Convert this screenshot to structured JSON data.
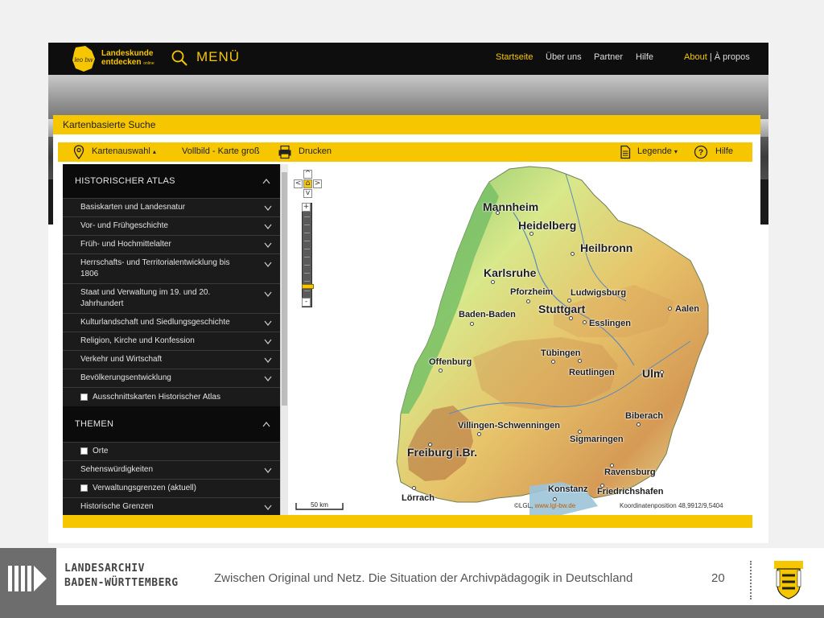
{
  "site": {
    "logo": {
      "badge": "leo bw",
      "line1": "Landeskunde",
      "line2": "entdecken",
      "line2_suffix": "online"
    },
    "menu_label": "MENÜ",
    "nav": [
      {
        "label": "Startseite",
        "active": true
      },
      {
        "label": "Über uns",
        "active": false
      },
      {
        "label": "Partner",
        "active": false
      },
      {
        "label": "Hilfe",
        "active": false
      }
    ],
    "about": {
      "about": "About",
      "separator": "|",
      "apropos": "À propos"
    }
  },
  "panel": {
    "title": "Kartenbasierte Suche",
    "toolbar": {
      "kartenauswahl": "Kartenauswahl",
      "vollbild": "Vollbild - Karte groß",
      "drucken": "Drucken",
      "legende": "Legende",
      "hilfe": "Hilfe"
    }
  },
  "sidebar": {
    "section1": {
      "title": "HISTORISCHER ATLAS",
      "items": [
        {
          "label": "Basiskarten und Landesnatur"
        },
        {
          "label": "Vor- und Frühgeschichte"
        },
        {
          "label": "Früh- und Hochmittelalter"
        },
        {
          "label": "Herrschafts- und Territorialentwicklung bis 1806"
        },
        {
          "label": "Staat und Verwaltung im 19. und 20. Jahrhundert"
        },
        {
          "label": "Kulturlandschaft und Siedlungsgeschichte"
        },
        {
          "label": "Religion, Kirche und Konfession"
        },
        {
          "label": "Verkehr und Wirtschaft"
        },
        {
          "label": "Bevölkerungsentwicklung"
        }
      ],
      "checkbox": "Ausschnittskarten Historischer Atlas"
    },
    "section2": {
      "title": "THEMEN",
      "orte": "Orte",
      "sehenswuerdigkeiten": "Sehenswürdigkeiten",
      "verwaltungsgrenzen": "Verwaltungsgrenzen (aktuell)",
      "historische_grenzen": "Historische Grenzen"
    }
  },
  "map": {
    "cities": [
      "Mannheim",
      "Heidelberg",
      "Heilbronn",
      "Karlsruhe",
      "Pforzheim",
      "Ludwigsburg",
      "Stuttgart",
      "Aalen",
      "Baden-Baden",
      "Esslingen",
      "Offenburg",
      "Tübingen",
      "Reutlingen",
      "Ulm",
      "Biberach",
      "Villingen-Schwenningen",
      "Sigmaringen",
      "Freiburg i.Br.",
      "Ravensburg",
      "Konstanz",
      "Friedrichshafen",
      "Lörrach"
    ],
    "scale_label": "50 km",
    "credit_prefix": "©LGL,",
    "credit_link": "www.lgl-bw.de",
    "coords_label": "Koordinatenposition",
    "coords_value": "48,9912/9,5404"
  },
  "footer": {
    "institution_line1": "LANDESARCHIV",
    "institution_line2": "BADEN-WÜRTTEMBERG",
    "title": "Zwischen Original und Netz. Die Situation der Archivpädagogik in Deutschland",
    "page": "20"
  }
}
